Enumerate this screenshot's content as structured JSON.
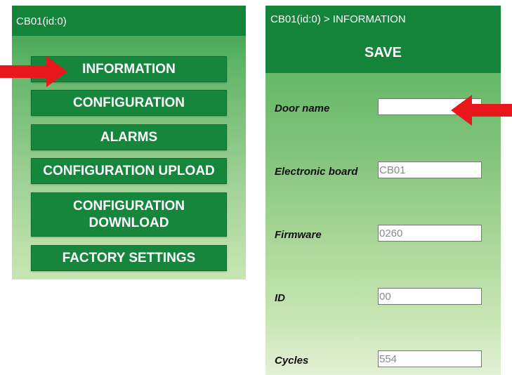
{
  "left_screen": {
    "title": "CB01(id:0)",
    "menu": {
      "information": "INFORMATION",
      "configuration": "CONFIGURATION",
      "alarms": "ALARMS",
      "configuration_upload": "CONFIGURATION UPLOAD",
      "configuration_download": "CONFIGURATION DOWNLOAD",
      "factory_settings": "FACTORY SETTINGS"
    }
  },
  "right_screen": {
    "breadcrumb": "CB01(id:0) > INFORMATION",
    "save_label": "SAVE",
    "fields": {
      "door_name": {
        "label": "Door name",
        "value": ""
      },
      "electronic_board": {
        "label": "Electronic board",
        "value": "CB01"
      },
      "firmware": {
        "label": "Firmware",
        "value": "0260"
      },
      "id": {
        "label": "ID",
        "value": "00"
      },
      "cycles": {
        "label": "Cycles",
        "value": "554"
      }
    }
  },
  "colors": {
    "header_green": "#13843a",
    "button_green": "#16863c",
    "arrow_red": "#e8171c"
  },
  "icons": {
    "pointer_right": "arrow-right-icon",
    "pointer_left": "arrow-left-icon"
  }
}
